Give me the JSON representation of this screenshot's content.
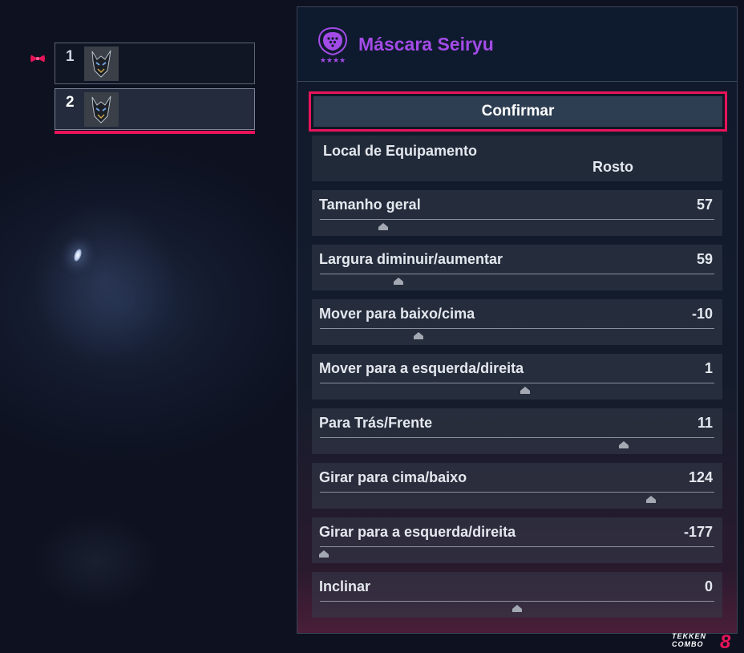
{
  "slots": [
    {
      "number": "1",
      "active": false
    },
    {
      "number": "2",
      "active": true
    }
  ],
  "item": {
    "name": "Máscara Seiryu",
    "rarity_stars": "★★★★",
    "icon": "mask-item-icon"
  },
  "confirm_label": "Confirmar",
  "equip_location": {
    "label": "Local de Equipamento",
    "value": "Rosto"
  },
  "sliders": [
    {
      "label": "Tamanho geral",
      "value": "57",
      "position": 0.16
    },
    {
      "label": "Largura diminuir/aumentar",
      "value": "59",
      "position": 0.2
    },
    {
      "label": "Mover para baixo/cima",
      "value": "-10",
      "position": 0.25
    },
    {
      "label": "Mover para a esquerda/direita",
      "value": "1",
      "position": 0.52
    },
    {
      "label": "Para Trás/Frente",
      "value": "11",
      "position": 0.77
    },
    {
      "label": "Girar para cima/baixo",
      "value": "124",
      "position": 0.84
    },
    {
      "label": "Girar para a esquerda/direita",
      "value": "-177",
      "position": 0.01
    },
    {
      "label": "Inclinar",
      "value": "0",
      "position": 0.5
    }
  ],
  "colors": {
    "accent": "#e8145a",
    "title": "#a24be6"
  },
  "logo": "TEKKEN COMBO 8"
}
